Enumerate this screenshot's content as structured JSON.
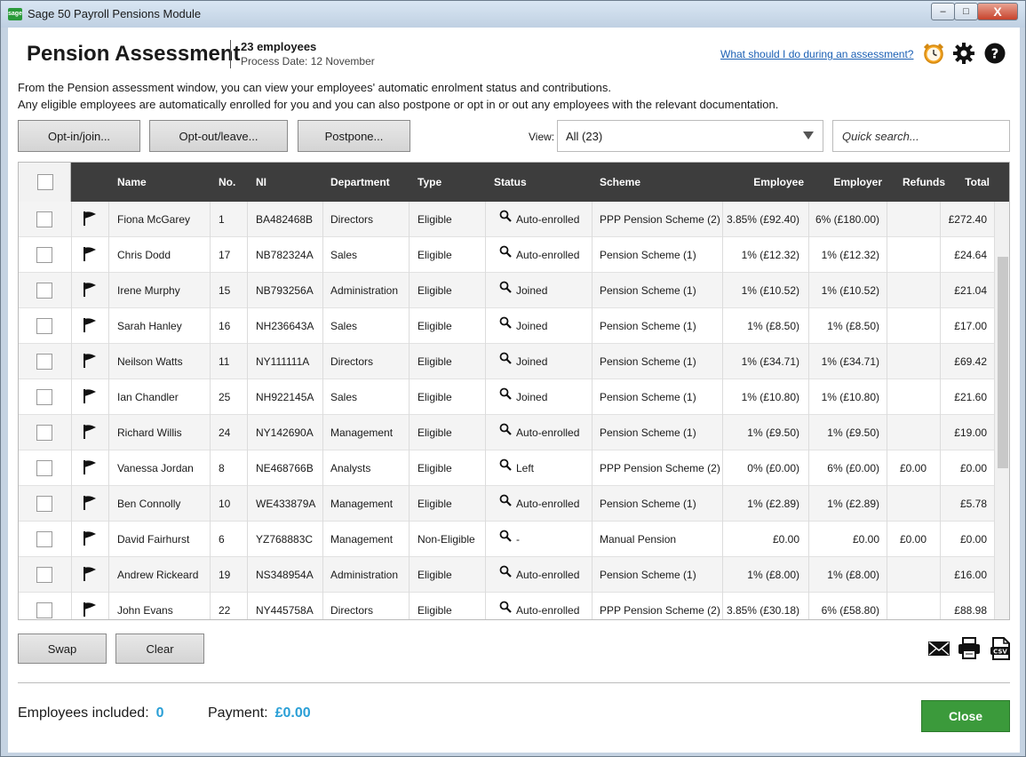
{
  "window": {
    "title": "Sage 50 Payroll Pensions Module",
    "logo_text": "sage",
    "min_label": "–",
    "max_label": "□",
    "close_label": "X"
  },
  "header": {
    "title": "Pension Assessment",
    "employee_count": "23 employees",
    "process_date": "Process Date: 12 November",
    "help_link": "What should I do during an assessment?"
  },
  "intro": {
    "line1": "From the Pension assessment window, you can view your employees' automatic enrolment status and contributions.",
    "line2": "Any eligible employees are automatically enrolled for you and you can also postpone or opt in or out any employees with the relevant documentation."
  },
  "toolbar": {
    "optin_label": "Opt-in/join...",
    "optout_label": "Opt-out/leave...",
    "postpone_label": "Postpone...",
    "view_label": "View:",
    "view_value": "All (23)",
    "search_placeholder": "Quick search..."
  },
  "table": {
    "columns": {
      "name": "Name",
      "no": "No.",
      "ni": "NI",
      "department": "Department",
      "type": "Type",
      "status": "Status",
      "scheme": "Scheme",
      "employee": "Employee",
      "employer": "Employer",
      "refunds": "Refunds",
      "total": "Total"
    },
    "rows": [
      {
        "name": "Fiona McGarey",
        "no": "1",
        "ni": "BA482468B",
        "department": "Directors",
        "type": "Eligible",
        "status": "Auto-enrolled",
        "scheme": "PPP Pension Scheme (2)",
        "employee": "3.85% (£92.40)",
        "employer": "6% (£180.00)",
        "refunds": "",
        "total": "£272.40"
      },
      {
        "name": "Chris Dodd",
        "no": "17",
        "ni": "NB782324A",
        "department": "Sales",
        "type": "Eligible",
        "status": "Auto-enrolled",
        "scheme": "Pension Scheme (1)",
        "employee": "1% (£12.32)",
        "employer": "1% (£12.32)",
        "refunds": "",
        "total": "£24.64"
      },
      {
        "name": "Irene Murphy",
        "no": "15",
        "ni": "NB793256A",
        "department": "Administration",
        "type": "Eligible",
        "status": "Joined",
        "scheme": "Pension Scheme (1)",
        "employee": "1% (£10.52)",
        "employer": "1% (£10.52)",
        "refunds": "",
        "total": "£21.04"
      },
      {
        "name": "Sarah Hanley",
        "no": "16",
        "ni": "NH236643A",
        "department": "Sales",
        "type": "Eligible",
        "status": "Joined",
        "scheme": "Pension Scheme (1)",
        "employee": "1% (£8.50)",
        "employer": "1% (£8.50)",
        "refunds": "",
        "total": "£17.00"
      },
      {
        "name": "Neilson Watts",
        "no": "11",
        "ni": "NY111111A",
        "department": "Directors",
        "type": "Eligible",
        "status": "Joined",
        "scheme": "Pension Scheme (1)",
        "employee": "1% (£34.71)",
        "employer": "1% (£34.71)",
        "refunds": "",
        "total": "£69.42"
      },
      {
        "name": "Ian Chandler",
        "no": "25",
        "ni": "NH922145A",
        "department": "Sales",
        "type": "Eligible",
        "status": "Joined",
        "scheme": "Pension Scheme (1)",
        "employee": "1% (£10.80)",
        "employer": "1% (£10.80)",
        "refunds": "",
        "total": "£21.60"
      },
      {
        "name": "Richard Willis",
        "no": "24",
        "ni": "NY142690A",
        "department": "Management",
        "type": "Eligible",
        "status": "Auto-enrolled",
        "scheme": "Pension Scheme (1)",
        "employee": "1% (£9.50)",
        "employer": "1% (£9.50)",
        "refunds": "",
        "total": "£19.00"
      },
      {
        "name": "Vanessa Jordan",
        "no": "8",
        "ni": "NE468766B",
        "department": "Analysts",
        "type": "Eligible",
        "status": "Left",
        "scheme": "PPP Pension Scheme (2)",
        "employee": "0% (£0.00)",
        "employer": "6% (£0.00)",
        "refunds": "£0.00",
        "total": "£0.00"
      },
      {
        "name": "Ben Connolly",
        "no": "10",
        "ni": "WE433879A",
        "department": "Management",
        "type": "Eligible",
        "status": "Auto-enrolled",
        "scheme": "Pension Scheme (1)",
        "employee": "1% (£2.89)",
        "employer": "1% (£2.89)",
        "refunds": "",
        "total": "£5.78"
      },
      {
        "name": "David Fairhurst",
        "no": "6",
        "ni": "YZ768883C",
        "department": "Management",
        "type": "Non-Eligible",
        "status": "-",
        "scheme": "Manual Pension",
        "employee": "£0.00",
        "employer": "£0.00",
        "refunds": "£0.00",
        "total": "£0.00"
      },
      {
        "name": "Andrew Rickeard",
        "no": "19",
        "ni": "NS348954A",
        "department": "Administration",
        "type": "Eligible",
        "status": "Auto-enrolled",
        "scheme": "Pension Scheme (1)",
        "employee": "1% (£8.00)",
        "employer": "1% (£8.00)",
        "refunds": "",
        "total": "£16.00"
      },
      {
        "name": "John Evans",
        "no": "22",
        "ni": "NY445758A",
        "department": "Directors",
        "type": "Eligible",
        "status": "Auto-enrolled",
        "scheme": "PPP Pension Scheme (2)",
        "employee": "3.85% (£30.18)",
        "employer": "6% (£58.80)",
        "refunds": "",
        "total": "£88.98"
      }
    ]
  },
  "footer": {
    "swap_label": "Swap",
    "clear_label": "Clear",
    "employees_included_label": "Employees included:",
    "employees_included_value": "0",
    "payment_label": "Payment:",
    "payment_value": "£0.00",
    "close_label": "Close"
  },
  "icons": {
    "alarm": "alarm-clock-icon",
    "gear": "gear-icon",
    "help": "help-icon",
    "flag": "flag-icon",
    "status": "magnifier-icon",
    "email": "email-icon",
    "print": "print-icon",
    "csv": "csv-icon"
  },
  "colors": {
    "accent": "#2a9fd6",
    "close_button": "#3b9a3b",
    "header_bg": "#3d3d3d",
    "alarm": "#f5a623",
    "link": "#1a5fb4"
  }
}
